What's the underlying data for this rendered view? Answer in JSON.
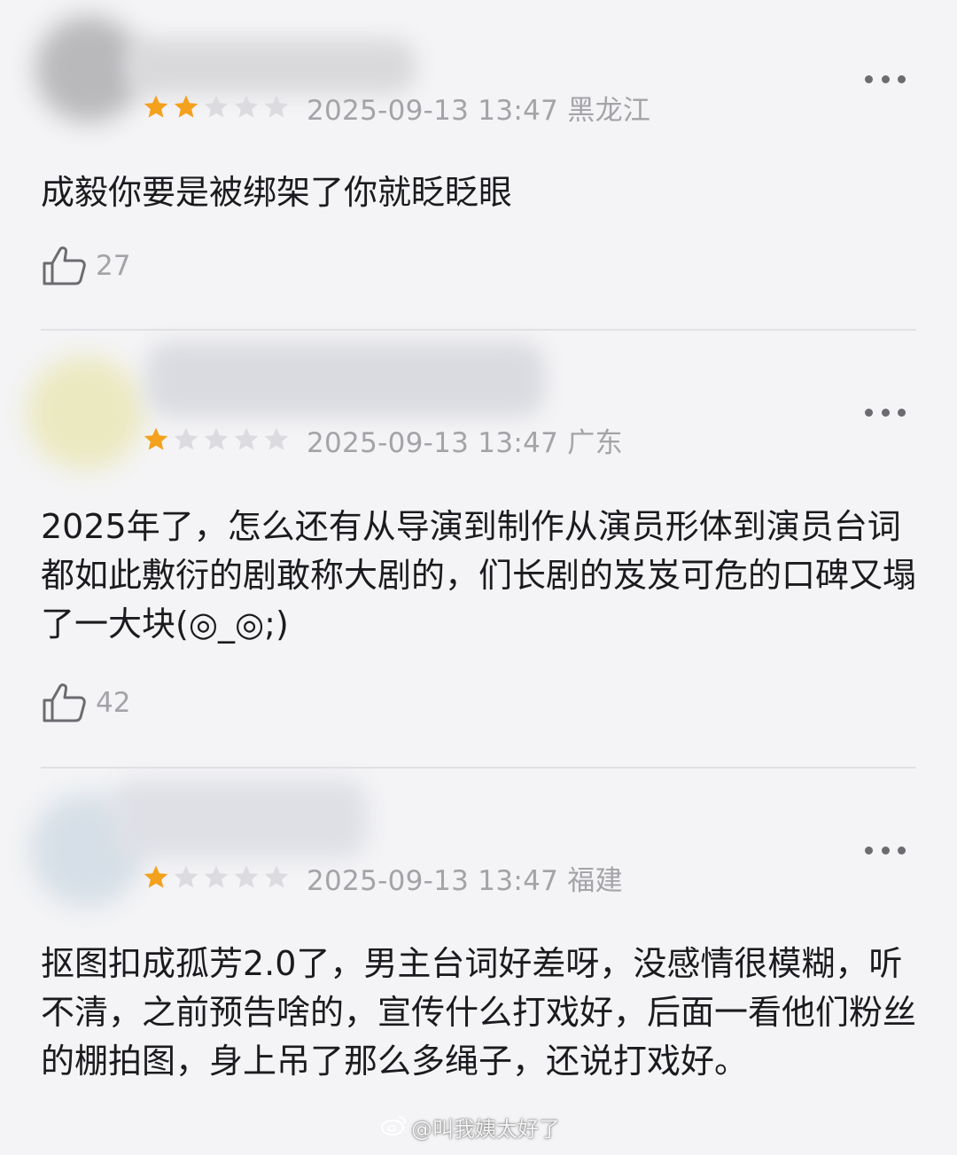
{
  "comments": [
    {
      "rating": 2,
      "timestamp": "2025-09-13 13:47",
      "location": "黑龙江",
      "text": "成毅你要是被绑架了你就眨眨眼",
      "likes": "27",
      "avatar_color": "#bdbdc0"
    },
    {
      "rating": 1,
      "timestamp": "2025-09-13 13:47",
      "location": "广东",
      "text": "2025年了，怎么还有从导演到制作从演员形体到演员台词都如此敷衍的剧敢称大剧的，们长剧的岌岌可危的口碑又塌了一大块(◎_◎;)",
      "likes": "42",
      "avatar_color": "#ecebc6"
    },
    {
      "rating": 1,
      "timestamp": "2025-09-13 13:47",
      "location": "福建",
      "text": "抠图扣成孤芳2.0了，男主台词好差呀，没感情很模糊，听不清，之前预告啥的，宣传什么打戏好，后面一看他们粉丝的棚拍图，身上吊了那么多绳子，还说打戏好。",
      "likes": "",
      "avatar_color": "#d8e1e8"
    }
  ],
  "icons": {
    "star": "star-icon",
    "like": "thumbs-up-icon",
    "more": "more-dots-icon"
  },
  "colors": {
    "star_filled": "#f4a11e",
    "star_empty": "#dcdce0",
    "meta_text": "#a3a3a8",
    "background": "#f4f4f6"
  },
  "watermark": {
    "text": "@叫我姨太好了"
  }
}
